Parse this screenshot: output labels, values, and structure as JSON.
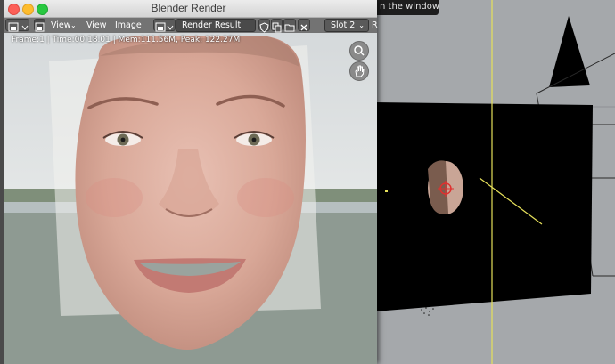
{
  "window": {
    "title": "Blender Render"
  },
  "tooltip": {
    "text": "n the window."
  },
  "header": {
    "view_menu_1": "View",
    "view_menu_2": "View",
    "image_menu": "Image",
    "image_name": "Render Result",
    "slot": "Slot 2",
    "truncated": "R"
  },
  "status": {
    "text": "Frame:1 | Time:00:18.01 | Mem:111.56M, Peak: 122.27M"
  },
  "icons": {
    "editor_type": "image-editor-icon",
    "view_mode": "image-icon",
    "image_browse": "image-browse-icon",
    "fake_user": "shield-icon",
    "copy": "copy-icon",
    "open": "folder-icon",
    "unlink": "close-icon",
    "zoom": "zoom-icon",
    "pan": "hand-icon"
  },
  "colors": {
    "titlebar": "#d9d9d9",
    "header": "#737373",
    "viewport_bg": "#a5a8ab"
  }
}
